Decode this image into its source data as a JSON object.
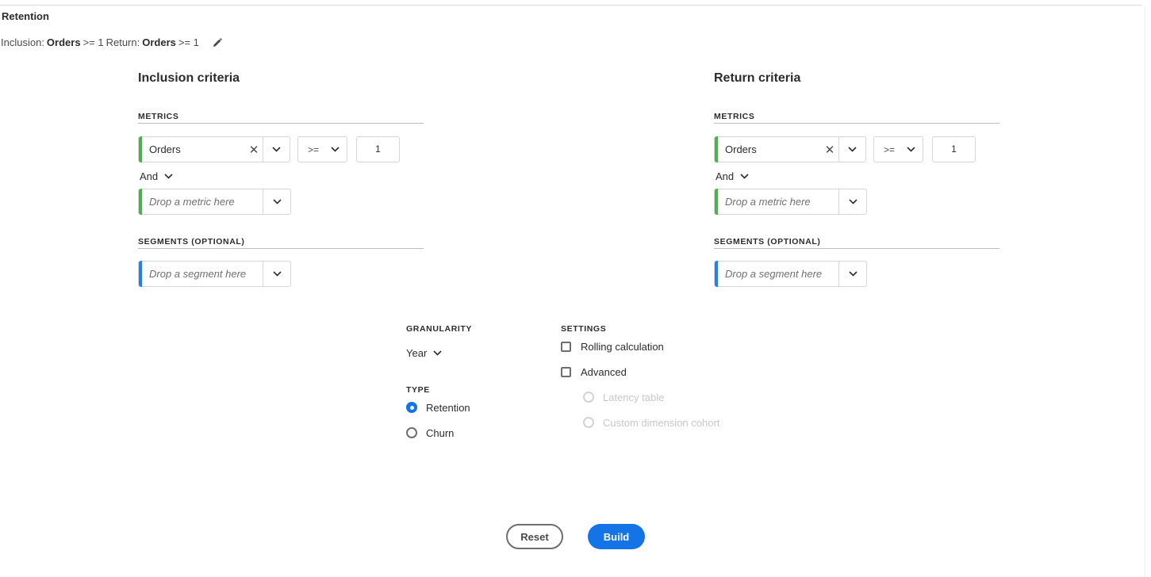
{
  "panel": {
    "title": "Retention",
    "summary": {
      "inclusion_label": "Inclusion:",
      "inclusion_metric": "Orders",
      "inclusion_condition": ">= 1",
      "return_label": "Return:",
      "return_metric": "Orders",
      "return_condition": ">= 1"
    }
  },
  "inclusion": {
    "title": "Inclusion criteria",
    "metrics_header": "METRICS",
    "metric_value": "Orders",
    "operator": ">=",
    "threshold": "1",
    "and_label": "And",
    "metric_placeholder": "Drop a metric here",
    "segments_header": "SEGMENTS (OPTIONAL)",
    "segment_placeholder": "Drop a segment here"
  },
  "return": {
    "title": "Return criteria",
    "metrics_header": "METRICS",
    "metric_value": "Orders",
    "operator": ">=",
    "threshold": "1",
    "and_label": "And",
    "metric_placeholder": "Drop a metric here",
    "segments_header": "SEGMENTS (OPTIONAL)",
    "segment_placeholder": "Drop a segment here"
  },
  "granularity": {
    "header": "GRANULARITY",
    "selected": "Year"
  },
  "type": {
    "header": "TYPE",
    "options": [
      {
        "label": "Retention",
        "selected": true
      },
      {
        "label": "Churn",
        "selected": false
      }
    ]
  },
  "settings": {
    "header": "SETTINGS",
    "rolling_label": "Rolling calculation",
    "rolling_checked": false,
    "advanced_label": "Advanced",
    "advanced_checked": false,
    "latency_label": "Latency table",
    "custom_cohort_label": "Custom dimension cohort"
  },
  "actions": {
    "reset_label": "Reset",
    "build_label": "Build"
  },
  "colors": {
    "accent": "#1473e6",
    "metric_bar": "#4caf50",
    "segment_bar": "#2680eb"
  }
}
